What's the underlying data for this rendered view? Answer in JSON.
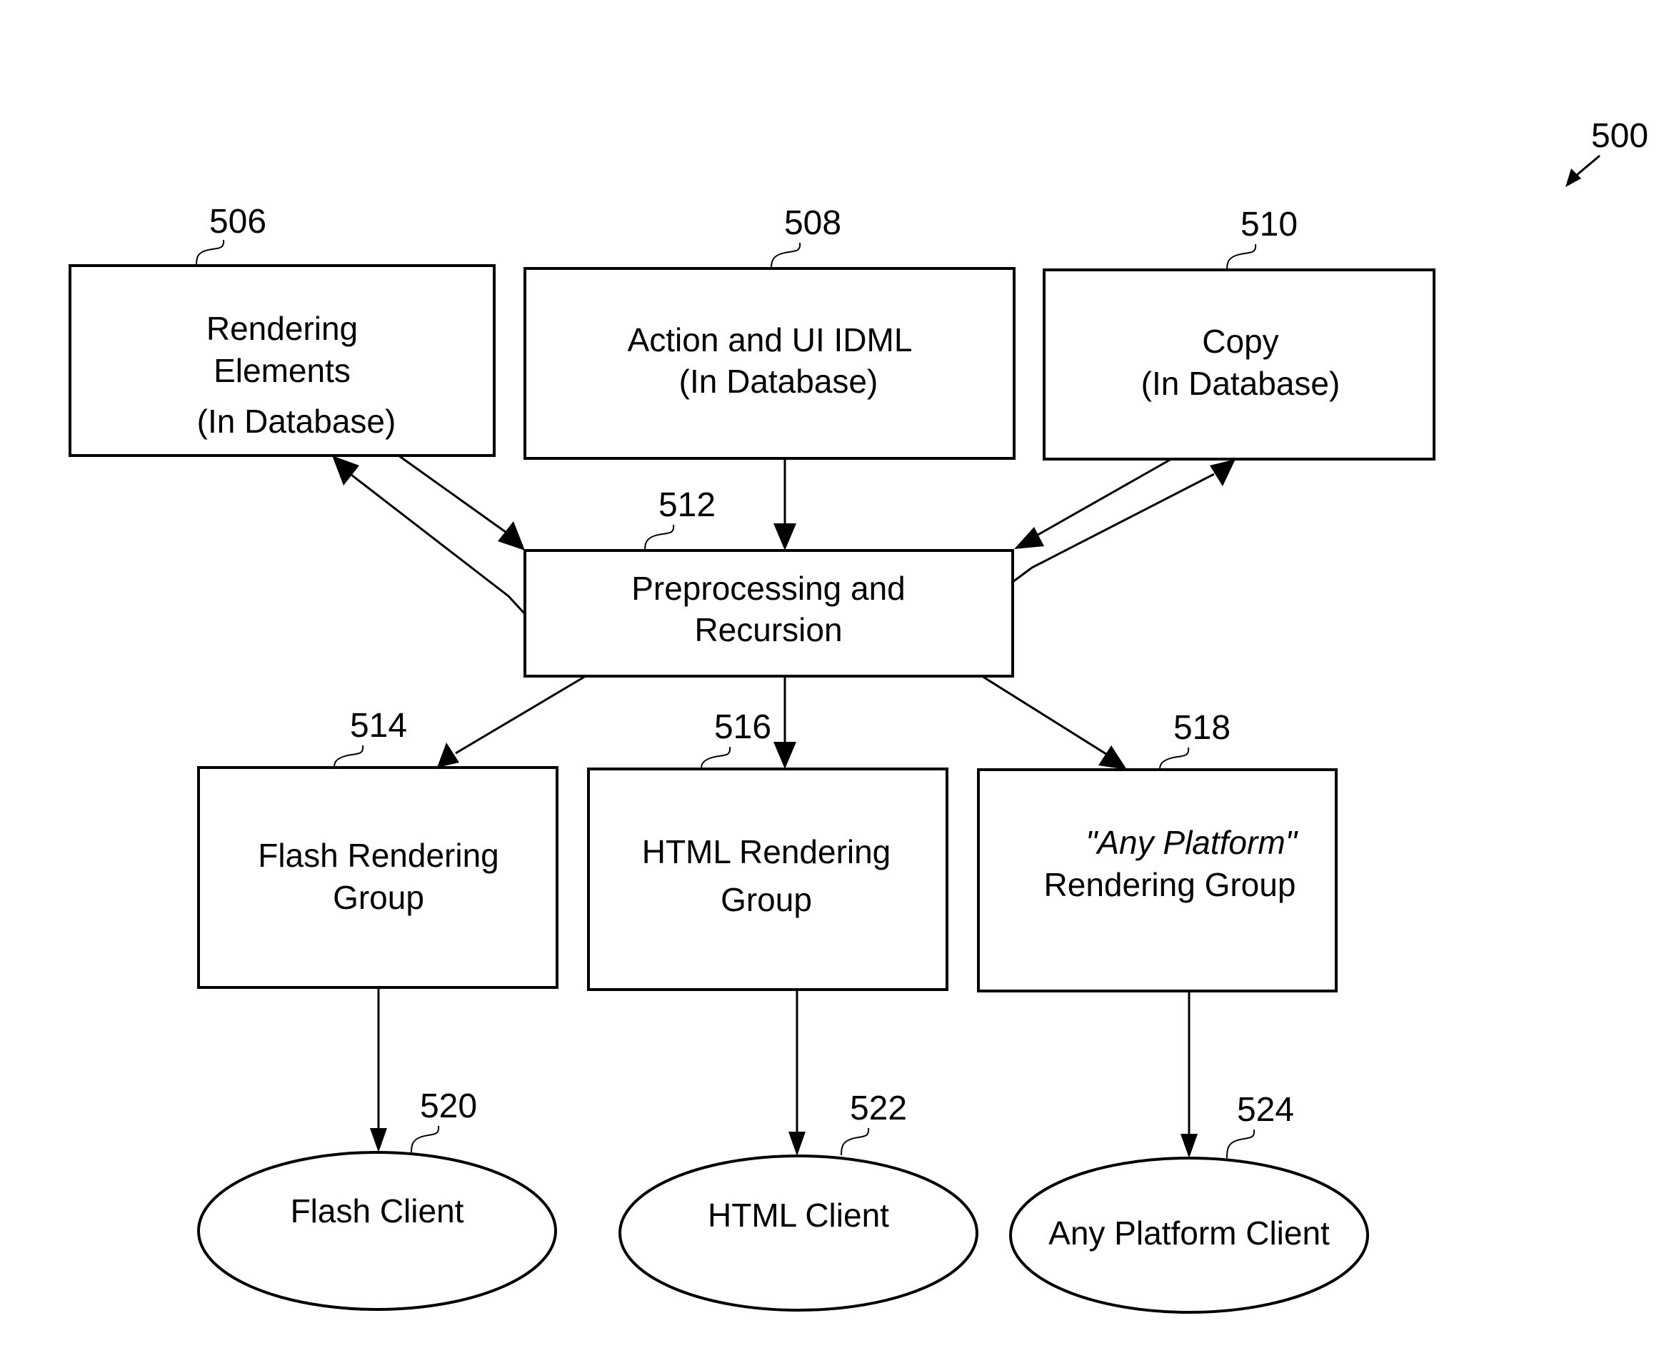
{
  "figure": {
    "ref": "500"
  },
  "nodes": {
    "rendering_elements": {
      "ref": "506",
      "lines": [
        "Rendering",
        "Elements",
        "(In Database)"
      ]
    },
    "action_ui_idml": {
      "ref": "508",
      "lines": [
        "Action and UI IDML",
        "(In Database)"
      ]
    },
    "copy": {
      "ref": "510",
      "lines": [
        "Copy",
        "(In Database)"
      ]
    },
    "preprocessing": {
      "ref": "512",
      "lines": [
        "Preprocessing and",
        "Recursion"
      ]
    },
    "flash_group": {
      "ref": "514",
      "lines": [
        "Flash Rendering",
        "Group"
      ]
    },
    "html_group": {
      "ref": "516",
      "lines": [
        "HTML Rendering",
        "Group"
      ]
    },
    "any_group": {
      "ref": "518",
      "lines": [
        "\"Any Platform\"",
        "Rendering Group"
      ]
    },
    "flash_client": {
      "ref": "520",
      "lines": [
        "Flash Client"
      ]
    },
    "html_client": {
      "ref": "522",
      "lines": [
        "HTML Client"
      ]
    },
    "any_client": {
      "ref": "524",
      "lines": [
        "Any Platform Client"
      ]
    }
  },
  "edges": [
    {
      "from": "506",
      "to": "512"
    },
    {
      "from": "512",
      "to": "506"
    },
    {
      "from": "508",
      "to": "512"
    },
    {
      "from": "510",
      "to": "512"
    },
    {
      "from": "512",
      "to": "510"
    },
    {
      "from": "512",
      "to": "514"
    },
    {
      "from": "512",
      "to": "516"
    },
    {
      "from": "512",
      "to": "518"
    },
    {
      "from": "514",
      "to": "520"
    },
    {
      "from": "516",
      "to": "522"
    },
    {
      "from": "518",
      "to": "524"
    }
  ]
}
